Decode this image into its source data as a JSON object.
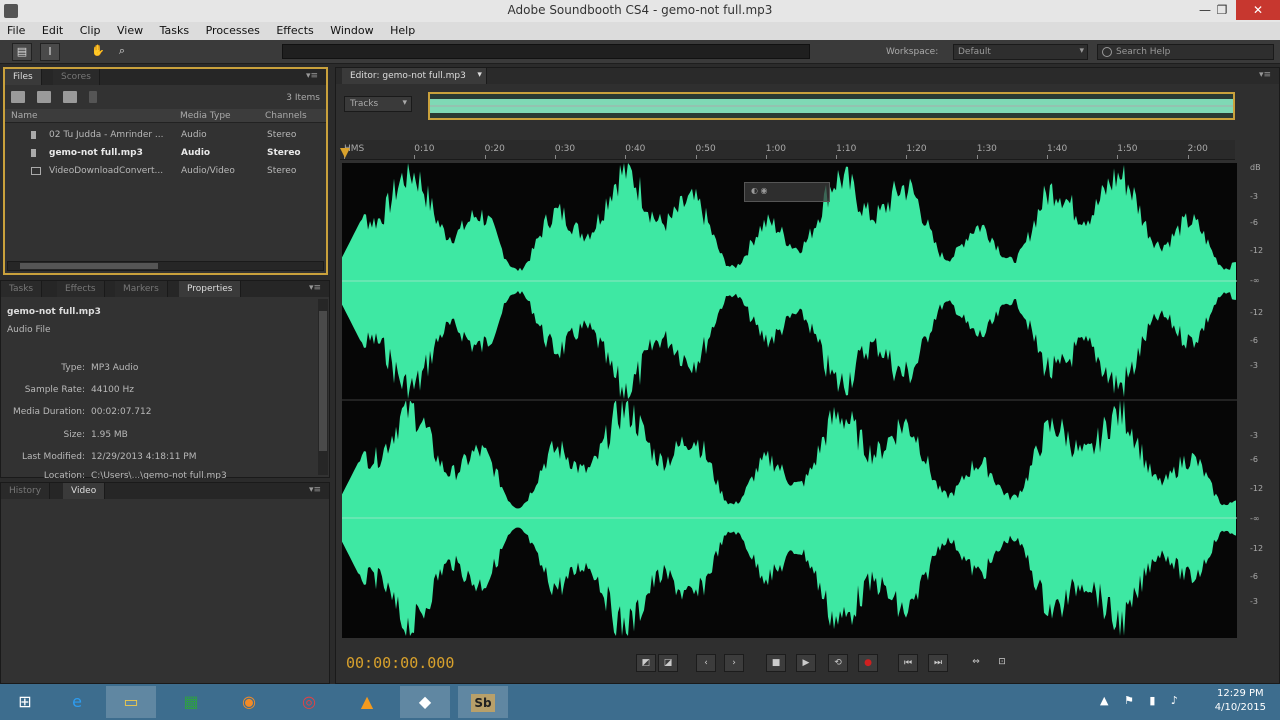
{
  "window": {
    "title": "Adobe Soundbooth CS4 - gemo-not full.mp3",
    "minimize": "—",
    "maximize": "❐",
    "close": "✕"
  },
  "menu": [
    "File",
    "Edit",
    "Clip",
    "View",
    "Tasks",
    "Processes",
    "Effects",
    "Window",
    "Help"
  ],
  "toolbar": {
    "workspace_label": "Workspace:",
    "workspace_value": "Default",
    "search_placeholder": "Search Help"
  },
  "files_panel": {
    "tabs": [
      "Files",
      "Scores"
    ],
    "item_count": "3 Items",
    "columns": [
      "Name",
      "Media Type",
      "Channels"
    ],
    "rows": [
      {
        "name": "02 Tu Judda - Amrinder ...",
        "media_type": "Audio",
        "channels": "Stereo"
      },
      {
        "name": "gemo-not full.mp3",
        "media_type": "Audio",
        "channels": "Stereo"
      },
      {
        "name": "VideoDownloadConvert...",
        "media_type": "Audio/Video",
        "channels": "Stereo"
      }
    ]
  },
  "properties_panel": {
    "tabs": [
      "Tasks",
      "Effects",
      "Markers",
      "Properties"
    ],
    "file_name": "gemo-not full.mp3",
    "file_kind": "Audio File",
    "rows": [
      {
        "label": "Type:",
        "value": "MP3 Audio"
      },
      {
        "label": "Sample Rate:",
        "value": "44100 Hz"
      },
      {
        "label": "Media Duration:",
        "value": "00:02:07.712"
      },
      {
        "label": "Size:",
        "value": "1.95 MB"
      },
      {
        "label": "Last Modified:",
        "value": "12/29/2013 4:18:11 PM"
      },
      {
        "label": "Location:",
        "value": "C:\\Users\\...\\gemo-not full.mp3"
      }
    ]
  },
  "video_panel": {
    "tabs": [
      "History",
      "Video"
    ]
  },
  "editor": {
    "tab_label": "Editor: gemo-not full.mp3",
    "tracks_select": "Tracks",
    "timeline_labels": [
      "HMS",
      "0:10",
      "0:20",
      "0:30",
      "0:40",
      "0:50",
      "1:00",
      "1:10",
      "1:20",
      "1:30",
      "1:40",
      "1:50",
      "2:00"
    ],
    "db_scale_top": [
      "dB",
      "-3",
      "-6",
      "-12",
      "-∞",
      "-12",
      "-6",
      "-3"
    ],
    "db_scale_bottom": [
      "-3",
      "-6",
      "-12",
      "-∞",
      "-12",
      "-6",
      "-3"
    ],
    "waveform_color": "#3ee8a3"
  },
  "transport": {
    "timecode": "00:00:00.000"
  },
  "taskbar": {
    "apps": [
      "windows-start",
      "internet-explorer",
      "file-explorer",
      "excel",
      "firefox",
      "chrome",
      "vlc",
      "app-icon",
      "soundbooth"
    ],
    "soundbooth_label": "Sb",
    "time": "12:29 PM",
    "date": "4/10/2015"
  }
}
